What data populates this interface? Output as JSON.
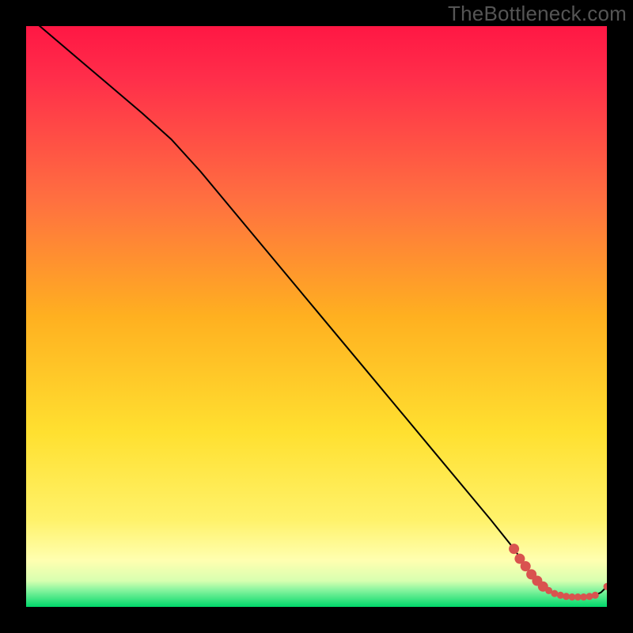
{
  "watermark": "TheBottleneck.com",
  "chart_data": {
    "type": "line",
    "title": "",
    "xlabel": "",
    "ylabel": "",
    "xlim": [
      0,
      100
    ],
    "ylim": [
      0,
      100
    ],
    "background_gradient": {
      "top": "#ff1744",
      "upper_mid": "#ff9800",
      "mid": "#ffeb3b",
      "lower_mid": "#ffff8d",
      "bottom": "#00e676"
    },
    "line_color": "#000000",
    "marker_color": "#d9534f",
    "series": [
      {
        "name": "curve",
        "x": [
          0,
          10,
          20,
          25,
          30,
          40,
          50,
          60,
          70,
          80,
          84,
          86,
          88,
          89,
          90,
          91,
          92,
          93,
          94,
          95,
          96,
          97,
          98,
          99,
          100
        ],
        "y": [
          102,
          93.5,
          85,
          80.5,
          75,
          63,
          51,
          39,
          27,
          15,
          10,
          7,
          4.5,
          3.5,
          2.8,
          2.3,
          2,
          1.8,
          1.7,
          1.7,
          1.7,
          1.8,
          2,
          2.5,
          3.5
        ]
      },
      {
        "name": "markers",
        "x": [
          84,
          85,
          86,
          87,
          88,
          89,
          90,
          91,
          92,
          93,
          94,
          95,
          96,
          97,
          98,
          100
        ],
        "y": [
          10,
          8.3,
          7,
          5.6,
          4.5,
          3.5,
          2.8,
          2.3,
          2,
          1.8,
          1.7,
          1.7,
          1.7,
          1.8,
          2,
          3.5
        ]
      }
    ]
  }
}
